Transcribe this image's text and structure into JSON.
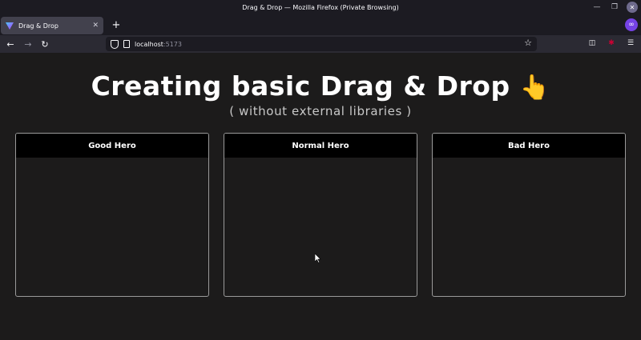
{
  "window": {
    "title": "Drag & Drop — Mozilla Firefox (Private Browsing)"
  },
  "tabs": [
    {
      "title": "Drag & Drop"
    }
  ],
  "navbar": {
    "url_host": "localhost",
    "url_port": ":5173"
  },
  "page": {
    "heading": "Creating basic Drag & Drop",
    "heading_emoji": "👆",
    "subheading": "( without external libraries )",
    "columns": [
      {
        "title": "Good Hero"
      },
      {
        "title": "Normal Hero"
      },
      {
        "title": "Bad Hero"
      }
    ]
  },
  "colors": {
    "page_background": "#1c1b1b",
    "column_header": "#000000",
    "column_border": "#9a9a9a",
    "private_accent": "#7542e5"
  }
}
